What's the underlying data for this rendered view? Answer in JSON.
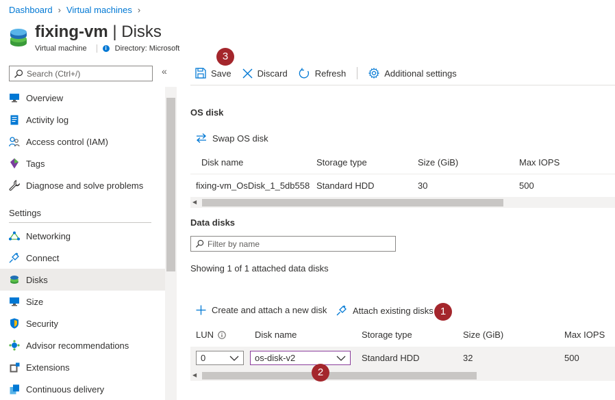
{
  "breadcrumb": {
    "items": [
      "Dashboard",
      "Virtual machines"
    ]
  },
  "header": {
    "title_name": "fixing-vm",
    "title_sep": "|",
    "title_section": "Disks",
    "subtitle_type": "Virtual machine",
    "directory_label": "Directory: Microsoft"
  },
  "sidebar": {
    "search_placeholder": "Search (Ctrl+/)",
    "collapse_glyph": "«",
    "items": [
      {
        "label": "Overview",
        "icon": "monitor-icon"
      },
      {
        "label": "Activity log",
        "icon": "log-icon"
      },
      {
        "label": "Access control (IAM)",
        "icon": "people-icon"
      },
      {
        "label": "Tags",
        "icon": "tag-icon"
      },
      {
        "label": "Diagnose and solve problems",
        "icon": "wrench-icon"
      }
    ],
    "settings_header": "Settings",
    "settings_items": [
      {
        "label": "Networking",
        "icon": "network-icon"
      },
      {
        "label": "Connect",
        "icon": "plug-icon"
      },
      {
        "label": "Disks",
        "icon": "disk-icon",
        "selected": true
      },
      {
        "label": "Size",
        "icon": "monitor-icon"
      },
      {
        "label": "Security",
        "icon": "shield-icon"
      },
      {
        "label": "Advisor recommendations",
        "icon": "advisor-icon"
      },
      {
        "label": "Extensions",
        "icon": "extensions-icon"
      },
      {
        "label": "Continuous delivery",
        "icon": "delivery-icon"
      }
    ]
  },
  "toolbar": {
    "save_label": "Save",
    "discard_label": "Discard",
    "refresh_label": "Refresh",
    "additional_settings_label": "Additional settings"
  },
  "callouts": {
    "one": "1",
    "two": "2",
    "three": "3"
  },
  "os_disk": {
    "heading": "OS disk",
    "swap_label": "Swap OS disk",
    "columns": [
      "Disk name",
      "Storage type",
      "Size (GiB)",
      "Max IOPS"
    ],
    "row": {
      "name": "fixing-vm_OsDisk_1_5db558",
      "storage_type": "Standard HDD",
      "size": "30",
      "max_iops": "500"
    }
  },
  "data_disks": {
    "heading": "Data disks",
    "filter_placeholder": "Filter by name",
    "showing_text": "Showing 1 of 1 attached data disks",
    "create_label": "Create and attach a new disk",
    "attach_label": "Attach existing disks",
    "columns": [
      "LUN",
      "Disk name",
      "Storage type",
      "Size (GiB)",
      "Max IOPS"
    ],
    "row": {
      "lun": "0",
      "name": "os-disk-v2",
      "storage_type": "Standard HDD",
      "size": "32",
      "max_iops": "500"
    }
  },
  "colors": {
    "accent": "#0078d4",
    "callout": "#a4262c",
    "selected_bg": "#edebe9"
  }
}
